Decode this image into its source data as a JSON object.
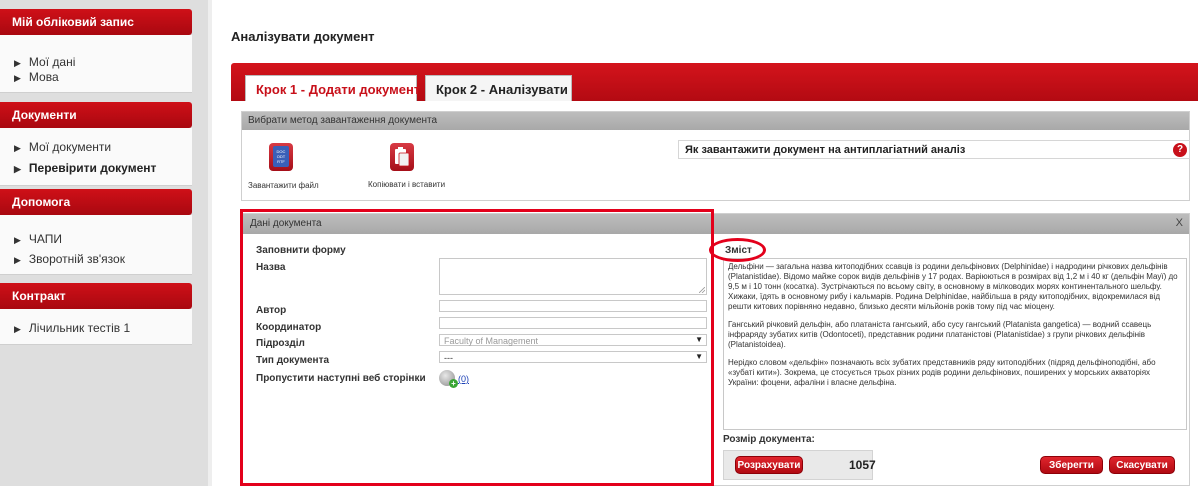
{
  "sidebar": {
    "sections": [
      {
        "title": "Мій обліковий запис",
        "items": [
          {
            "label": "Мої дані"
          },
          {
            "label": "Мова"
          }
        ]
      },
      {
        "title": "Документи",
        "items": [
          {
            "label": "Мої документи"
          },
          {
            "label": "Перевірити документ"
          }
        ]
      },
      {
        "title": "Допомога",
        "items": [
          {
            "label": "ЧАПИ"
          },
          {
            "label": "Зворотній зв'язок"
          }
        ]
      },
      {
        "title": "Контракт",
        "items": [
          {
            "label": "Лічильник тестів 1"
          }
        ]
      }
    ]
  },
  "page": {
    "title": "Аналізувати документ"
  },
  "tabs": [
    {
      "label": "Крок 1 - Додати документ",
      "active": true
    },
    {
      "label": "Крок 2 - Аналізувати",
      "active": false
    }
  ],
  "method_panel": {
    "title": "Вибрати метод завантаження документа",
    "upload_label": "Завантажити файл",
    "upload_icon_text": "DOC\nODT\nRTF",
    "paste_label": "Копіювати і вставити",
    "howto_text": "Як завантажити документ на антиплагіатний аналіз",
    "help_icon": "?"
  },
  "doc_panel": {
    "title": "Дані документа",
    "close_label": "X",
    "form_heading": "Заповнити форму",
    "fields": {
      "name_label": "Назва",
      "author_label": "Автор",
      "coordinator_label": "Координатор",
      "department_label": "Підрозділ",
      "department_value": "Faculty of Management",
      "doctype_label": "Тип документа",
      "doctype_value": "---",
      "skip_label": "Пропустити наступні веб сторінки",
      "skip_count": "(0)"
    },
    "content_label": "Зміст",
    "content_paragraphs": [
      "Дельфіни — загальна назва китоподібних ссавців із родини дельфінових (Delphinidae) і надродини річкових дельфінів (Platanistidae). Відомо майже сорок видів дельфінів у 17 родах. Варіюються в розмірах від 1,2 м і 40 кг (дельфін Мауї) до 9,5 м і 10 тонн (косатка). Зустрічаються по всьому світу, в основному в мілководих морях континентального шельфу. Хижаки, їдять в основному рибу і кальмарів. Родина Delphinidae, найбільша в ряду китоподібних, відокремилася від решти китових порівняно недавно, близько десяти мільйонів років тому під час міоцену.",
      "Гангський річковий дельфін, або платаніста гангський, або сусу гангський (Platanista gangetica) — водний ссавець інфраряду зубатих китів (Odontoceti), представник родини платаністові (Platanistidae) з групи річкових дельфінів (Platanistoidea).",
      "Нерідко словом «дельфін» позначають всіх зубатих представників ряду китоподібних (підряд дельфіноподібні, або «зубаті кити»). Зокрема, це стосується трьох різних родів родини дельфінових, поширених у морських акваторіях України: фоцени, афаліни і власне дельфіна."
    ],
    "size_label": "Розмір документа:",
    "count_button": "Розрахувати",
    "size_value": "1057",
    "save_button": "Зберегти",
    "cancel_button": "Скасувати"
  },
  "colors": {
    "brand_red": "#c8101a",
    "annotation_red": "#e3001b"
  }
}
